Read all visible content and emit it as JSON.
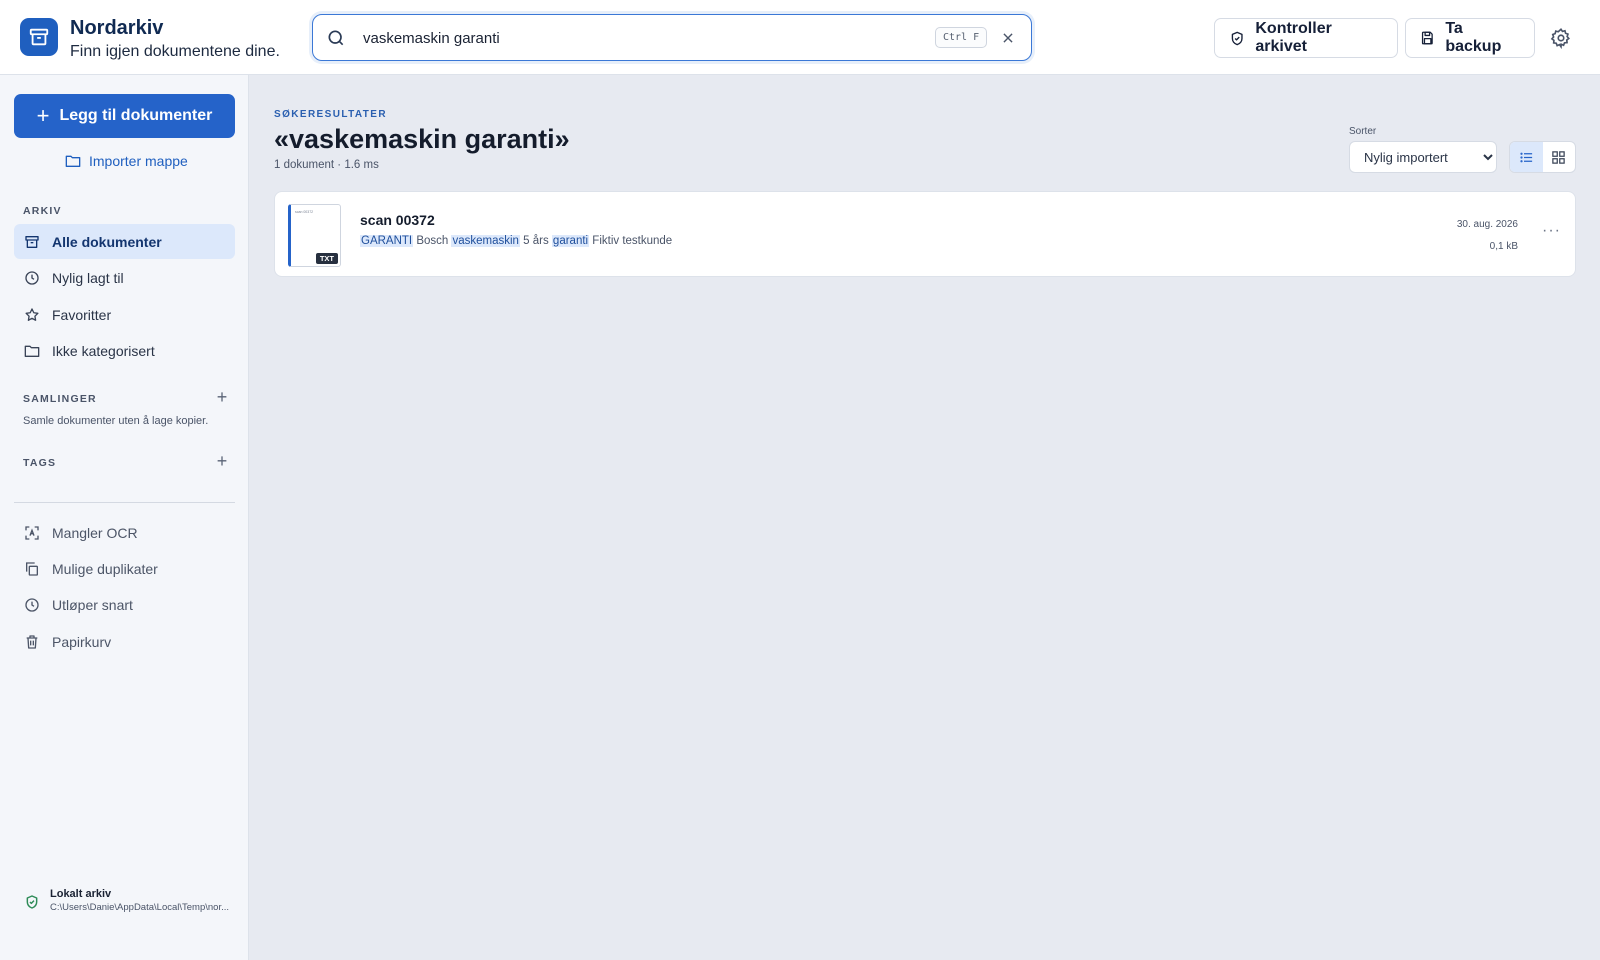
{
  "app": {
    "name": "Nordarkiv",
    "tagline": "Finn igjen dokumentene dine."
  },
  "search": {
    "value": "vaskemaskin garanti",
    "shortcut": "Ctrl F"
  },
  "header": {
    "check_label": "Kontroller arkivet",
    "backup_label": "Ta backup"
  },
  "sidebar": {
    "add_label": "Legg til dokumenter",
    "import_label": "Importer mappe",
    "archive_heading": "ARKIV",
    "archive_items": [
      {
        "label": "Alle dokumenter",
        "icon": "archive-box-icon",
        "active": true
      },
      {
        "label": "Nylig lagt til",
        "icon": "clock-icon"
      },
      {
        "label": "Favoritter",
        "icon": "star-icon"
      },
      {
        "label": "Ikke kategorisert",
        "icon": "folder-icon"
      }
    ],
    "collections_heading": "SAMLINGER",
    "collections_hint": "Samle dokumenter uten å lage kopier.",
    "tags_heading": "TAGS",
    "tool_items": [
      {
        "label": "Mangler OCR",
        "icon": "scan-text-icon"
      },
      {
        "label": "Mulige duplikater",
        "icon": "copy-icon"
      },
      {
        "label": "Utløper snart",
        "icon": "clock-icon"
      },
      {
        "label": "Papirkurv",
        "icon": "trash-icon"
      }
    ],
    "status_title": "Lokalt arkiv",
    "status_path": "C:\\Users\\Danie\\AppData\\Local\\Temp\\nor..."
  },
  "main": {
    "eyebrow": "SØKERESULTATER",
    "title": "«vaskemaskin garanti»",
    "meta": "1 dokument · 1.6 ms",
    "sort_label": "Sorter",
    "sort_value": "Nylig importert",
    "sort_options": [
      "Nylig importert"
    ]
  },
  "results": [
    {
      "title": "scan 00372",
      "thumb_text": "scan 00372",
      "badge": "TXT",
      "snippet": [
        {
          "t": "GARANTI",
          "hl": true
        },
        {
          "t": " Bosch ",
          "hl": false
        },
        {
          "t": "vaskemaskin",
          "hl": true
        },
        {
          "t": " 5 års ",
          "hl": false
        },
        {
          "t": "garanti",
          "hl": true
        },
        {
          "t": " Fiktiv testkunde",
          "hl": false
        }
      ],
      "date": "30. aug. 2026",
      "size": "0,1 kB",
      "menu": "···"
    }
  ],
  "colors": {
    "accent": "#2563c9",
    "active_bg": "#dce8fb",
    "status_ok": "#2e8b57"
  }
}
